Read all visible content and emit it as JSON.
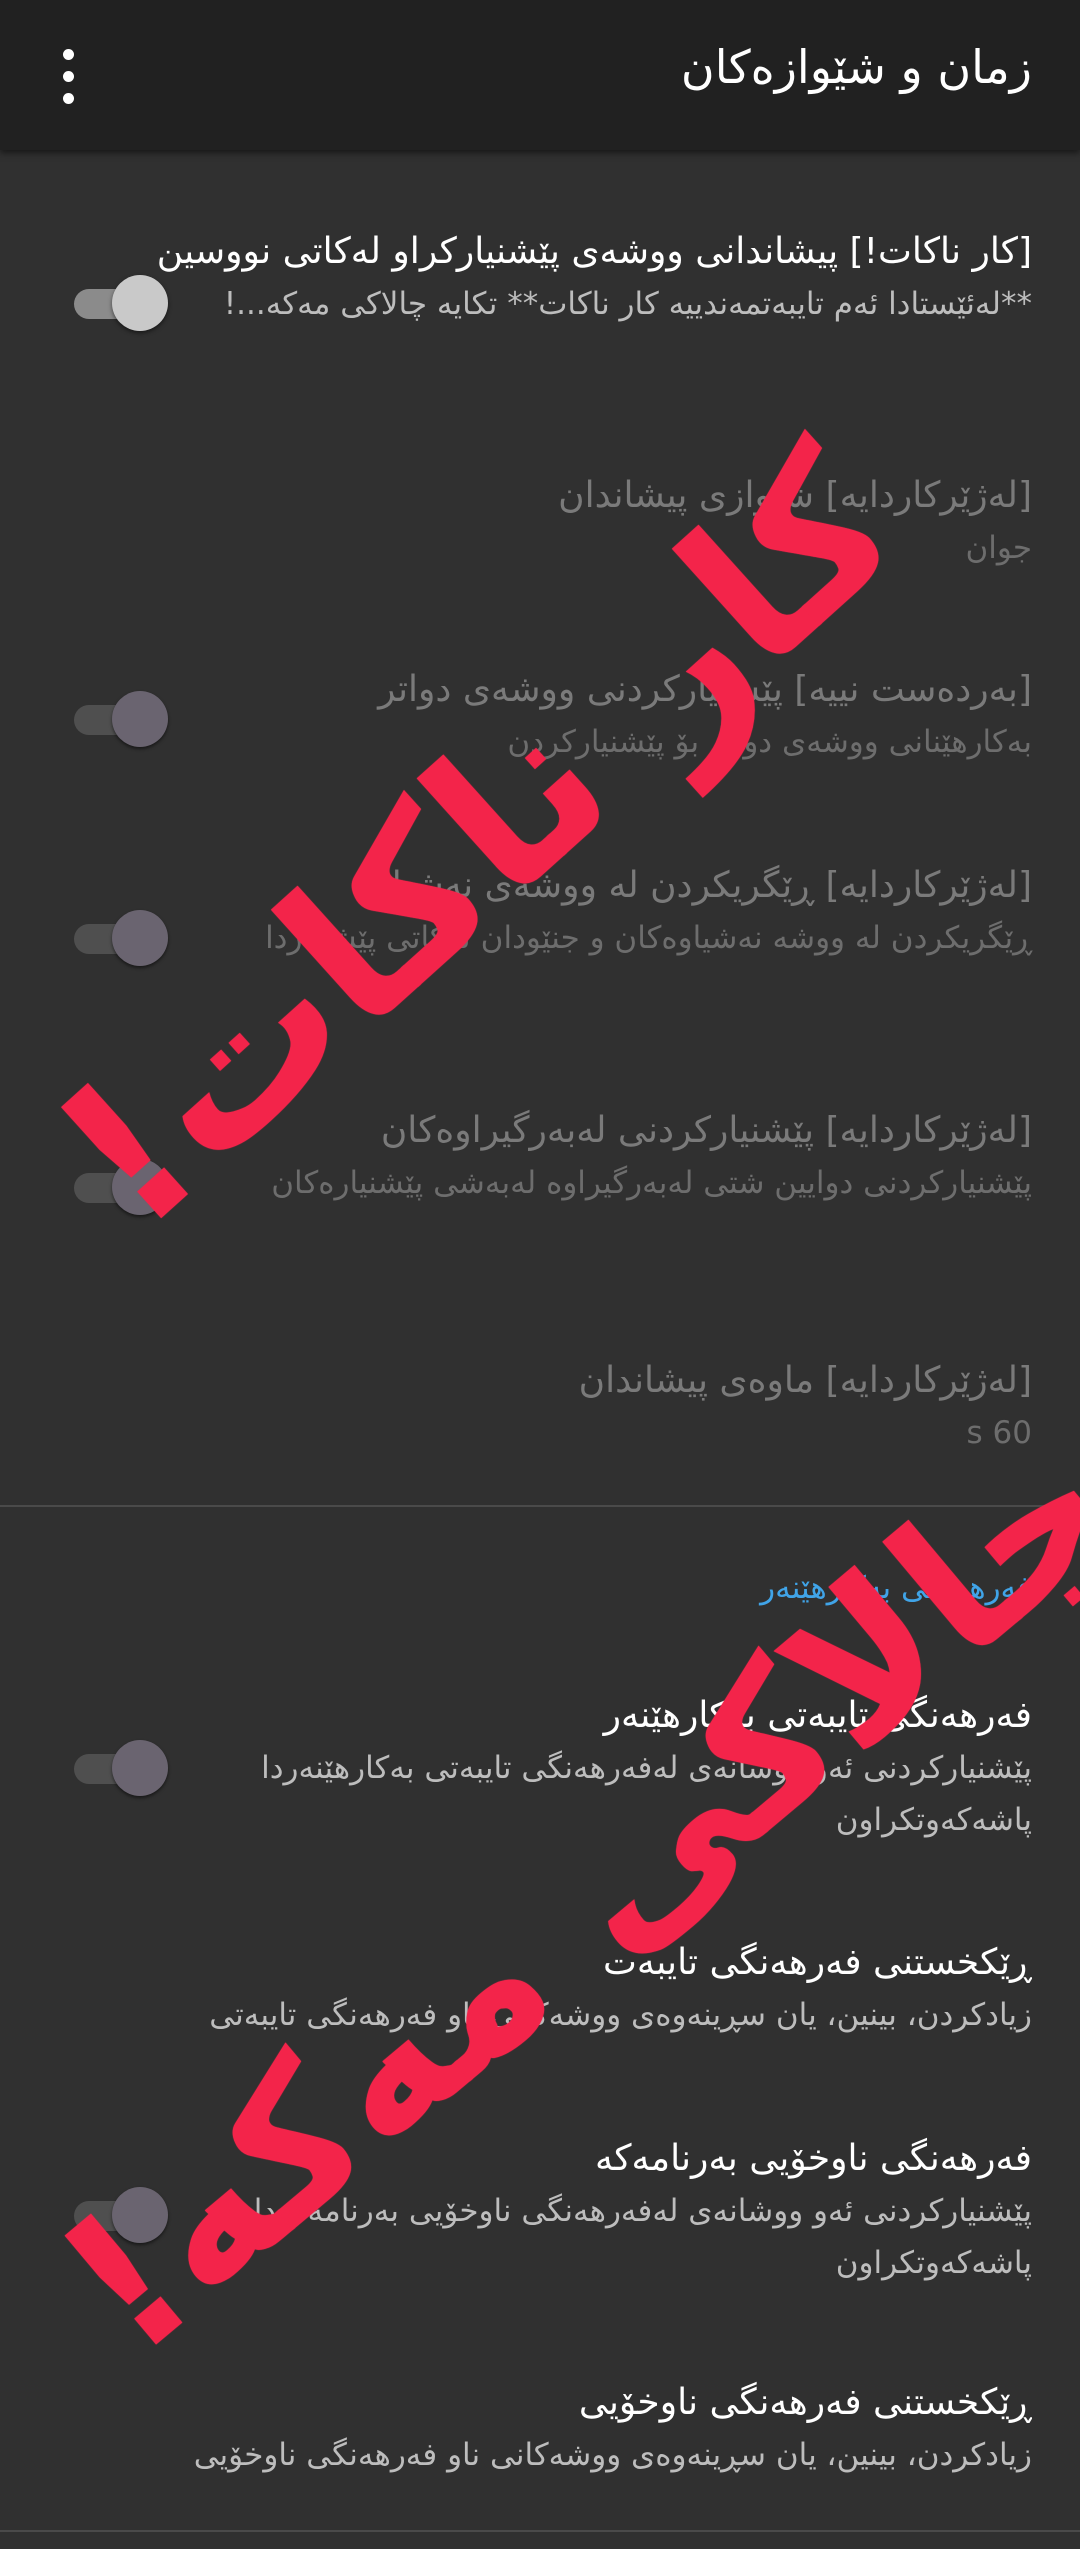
{
  "appbar": {
    "title": "زمان و شێوازەکان",
    "overflow_icon": "more-vert-icon"
  },
  "preferences": [
    {
      "title": "[کار ناکات!] پیشاندانی ووشەی پێشنیارکراو لەکاتی نووسین",
      "summary": "**لەئێستادا ئەم تایبەتمەندییە کار ناکات** تکایە چالاکی مەکە...!",
      "switch": "on"
    },
    {
      "title": "[لەژێرکاردایە] شێوازی پیشاندان",
      "summary": "جوان"
    },
    {
      "title": "[بەردەست نییە] پێشنیارکردنی ووشەی دواتر",
      "summary": "بەکارهێنانی ووشەی دواتر بۆ پێشنیارکردن",
      "switch": "off"
    },
    {
      "title": "[لەژێرکاردایە] ڕێگریکردن لە ووشەی نەشیاو",
      "summary": "ڕێگریکردن لە ووشە نەشیاوەکان و جنێودان لەکاتی پێشنیاردا",
      "switch": "off"
    },
    {
      "title": "[لەژێرکاردایە] پێشنیارکردنی لەبەرگیراوەکان",
      "summary": "پێشنیارکردنی دوایین شتی لەبەرگیراوە لەبەشی پێشنیارەکان",
      "switch": "off"
    },
    {
      "title": "[لەژێرکاردایە] ماوەی پیشاندان",
      "summary": "60 s"
    }
  ],
  "category": "فەرهەنگی بەکارهێنەر",
  "dictionary_preferences": [
    {
      "title": "فەرهەنگی تایبەتی بەکارهێنەر",
      "summary": "پێشنیارکردنی ئەو ووشانەی لەفەرهەنگی تایبەتی بەکارهێنەردا پاشەکەوتکراون",
      "switch": "off"
    },
    {
      "title": "ڕێکخستنی فەرهەنگی تایبەت",
      "summary": "زیادکردن، بینین، یان سڕینەوەی ووشەکانی ناو فەرهەنگی تایبەتی"
    },
    {
      "title": "فەرهەنگی ناوخۆیی بەرنامەکە",
      "summary": "پێشنیارکردنی ئەو ووشانەی لەفەرهەنگی ناوخۆیی بەرنامەکەدا پاشەکەوتکراون",
      "switch": "off"
    },
    {
      "title": "ڕێکخستنی فەرهەنگی ناوخۆیی",
      "summary": "زیادکردن، بینین، یان سڕینەوەی ووشەکانی ناو فەرهەنگی ناوخۆیی"
    }
  ],
  "overlay_lines": [
    "کار ناکات!",
    "چالاکی مەکە!"
  ],
  "colors": {
    "background": "#303030",
    "appbar": "#212121",
    "accent": "#40a4e8",
    "overlay": "#f3244a"
  }
}
